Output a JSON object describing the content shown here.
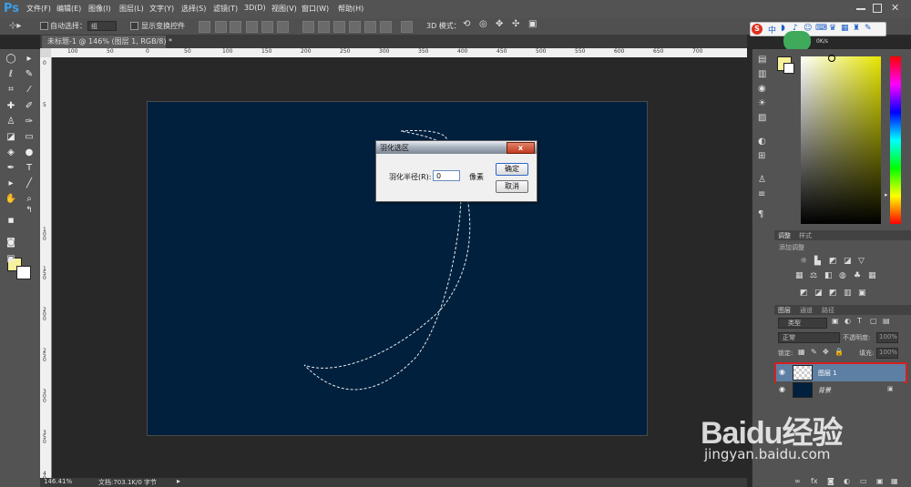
{
  "app": {
    "logo": "Ps"
  },
  "menubar": {
    "items": [
      "文件(F)",
      "编辑(E)",
      "图像(I)",
      "图层(L)",
      "文字(Y)",
      "选择(S)",
      "滤镜(T)",
      "3D(D)",
      "视图(V)",
      "窗口(W)",
      "帮助(H)"
    ]
  },
  "options": {
    "auto_select_label": "自动选择：",
    "auto_select_value": "组",
    "show_transform_label": "显示变换控件",
    "mode_3d_label": "3D 模式："
  },
  "document": {
    "tab_title": "未标题-1 @ 146% (图层 1, RGB/8) *",
    "ruler_h_ticks": [
      "100",
      "50",
      "0",
      "50",
      "100",
      "150",
      "200",
      "250",
      "300",
      "350",
      "400",
      "450",
      "500",
      "550",
      "600",
      "650",
      "700"
    ],
    "ruler_v_ticks": [
      "0",
      "5",
      "1 0 0",
      "1 5 0",
      "2 0 0",
      "2 5 0",
      "3 0 0",
      "3 5 0",
      "4 0 0"
    ],
    "canvas_color": "#01203d"
  },
  "status": {
    "zoom": "146.41%",
    "doc_info": "文档:703.1K/0 字节"
  },
  "colors": {
    "foreground": "#f8f29a",
    "background": "#ffffff"
  },
  "panels": {
    "adjust_tabs": [
      "调整",
      "样式"
    ],
    "adjust_hint": "添加调整",
    "layer_tabs": [
      "图层",
      "通道",
      "路径"
    ],
    "kind_label": "类型",
    "blend_mode": "正常",
    "opacity_label": "不透明度:",
    "opacity_value": "100%",
    "lock_label": "锁定:",
    "fill_label": "填充:",
    "fill_value": "100%",
    "layers": [
      {
        "name": "图层 1",
        "selected": true
      },
      {
        "name": "背景",
        "selected": false
      }
    ],
    "speed": "0K/s"
  },
  "ime": {
    "label": "中"
  },
  "dialog": {
    "title": "羽化选区",
    "close_glyph": "x",
    "feather_label": "羽化半径(R):",
    "feather_value": "0",
    "unit": "像素",
    "ok": "确定",
    "cancel": "取消"
  },
  "watermark": {
    "brand": "Baidu经验",
    "url": "jingyan.baidu.com"
  }
}
